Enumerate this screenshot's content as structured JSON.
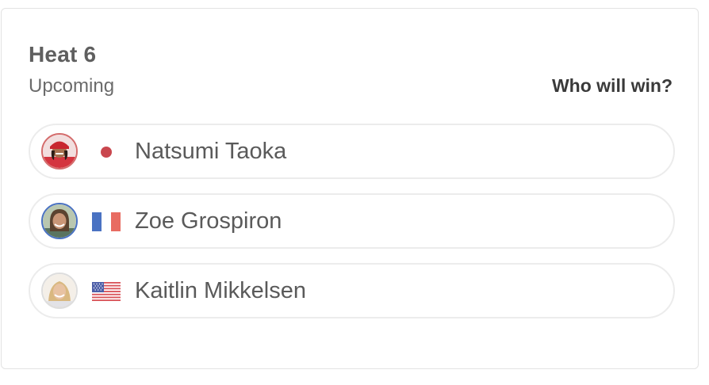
{
  "heat": {
    "title": "Heat 6",
    "status": "Upcoming",
    "cta_label": "Who will win?"
  },
  "competitors": [
    {
      "name": "Natsumi Taoka",
      "country": "Japan",
      "flag_icon": "japan-flag-icon",
      "avatar_ring_color": "#d46b6b"
    },
    {
      "name": "Zoe Grospiron",
      "country": "France",
      "flag_icon": "france-flag-icon",
      "avatar_ring_color": "#4a72c2"
    },
    {
      "name": "Kaitlin Mikkelsen",
      "country": "United States",
      "flag_icon": "usa-flag-icon",
      "avatar_ring_color": "#dddddd"
    }
  ]
}
